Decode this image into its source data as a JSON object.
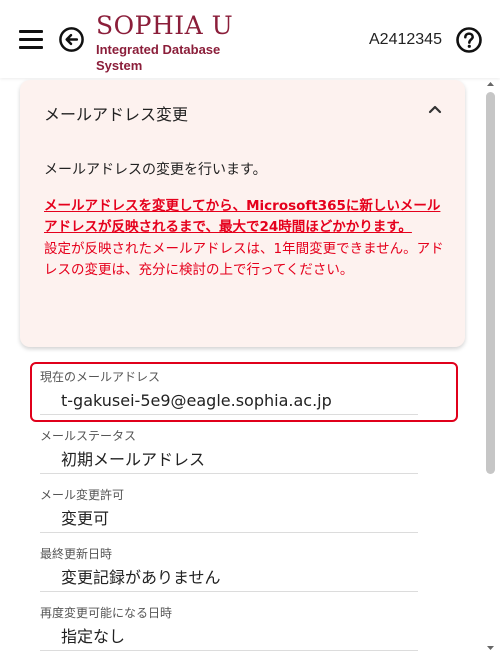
{
  "header": {
    "logo_title": "SOPHIA U",
    "logo_subtitle": "Integrated Database System",
    "user_id": "A2412345",
    "icons": [
      "menu-icon",
      "back-arrow-icon",
      "help-icon"
    ]
  },
  "card": {
    "title": "メールアドレス変更",
    "intro": "メールアドレスの変更を行います。",
    "warning_strong": "メールアドレスを変更してから、Microsoft365に新しいメールアドレスが反映されるまで、最大で24時間ほどかかります。",
    "warning_normal": "設定が反映されたメールアドレスは、1年間変更できません。アドレスの変更は、充分に検討の上で行ってください。"
  },
  "fields": [
    {
      "label": "現在のメールアドレス",
      "value": "t-gakusei-5e9@eagle.sophia.ac.jp"
    },
    {
      "label": "メールステータス",
      "value": "初期メールアドレス"
    },
    {
      "label": "メール変更許可",
      "value": "変更可"
    },
    {
      "label": "最終更新日時",
      "value": "変更記録がありません"
    },
    {
      "label": "再度変更可能になる日時",
      "value": "指定なし"
    }
  ],
  "colors": {
    "brand": "#8b1e3a",
    "warning": "#e5001c",
    "card_bg": "#fdf2ef",
    "highlight_border": "#e0001b"
  }
}
